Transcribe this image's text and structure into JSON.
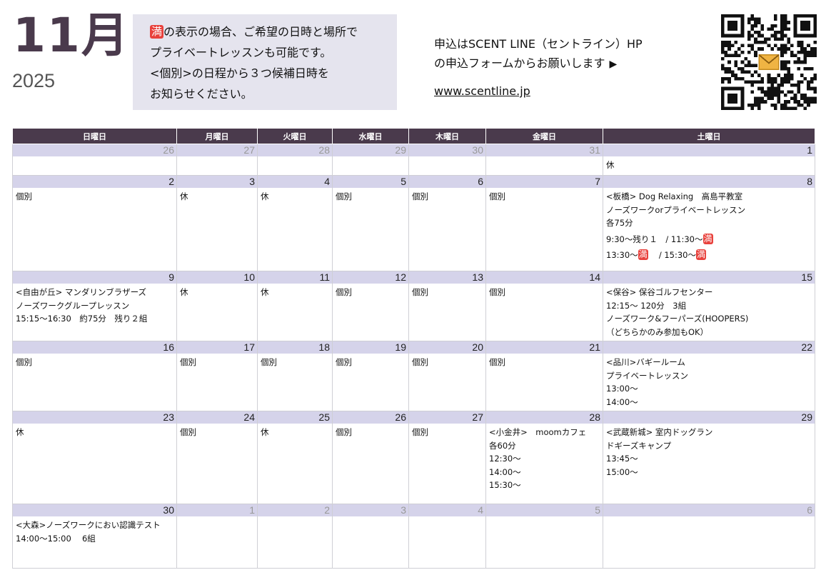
{
  "header": {
    "month": "11月",
    "year": "2025",
    "notice": {
      "badge": "満",
      "line1_after_badge": "の表示の場合、ご希望の日時と場所で",
      "line2": "プライベートレッスンも可能です。",
      "line3": "<個別>の日程から３つ候補日時を",
      "line4": "お知らせください。"
    },
    "apply": {
      "line1": "申込はSCENT LINE（セントライン）HP",
      "line2": "の申込フォームからお願いします",
      "arrow": "▶",
      "link": "www.scentline.jp"
    }
  },
  "calendar": {
    "weekdays": [
      "日曜日",
      "月曜日",
      "火曜日",
      "水曜日",
      "木曜日",
      "金曜日",
      "土曜日"
    ],
    "full_badge": "満",
    "weeks": [
      [
        {
          "day": "26",
          "other": true,
          "lines": []
        },
        {
          "day": "27",
          "other": true,
          "lines": []
        },
        {
          "day": "28",
          "other": true,
          "lines": []
        },
        {
          "day": "29",
          "other": true,
          "lines": []
        },
        {
          "day": "30",
          "other": true,
          "lines": []
        },
        {
          "day": "31",
          "other": true,
          "lines": []
        },
        {
          "day": "1",
          "lines": [
            "休"
          ]
        }
      ],
      [
        {
          "day": "2",
          "lines": [
            "個別"
          ]
        },
        {
          "day": "3",
          "lines": [
            "休"
          ]
        },
        {
          "day": "4",
          "lines": [
            "休"
          ]
        },
        {
          "day": "5",
          "lines": [
            "個別"
          ]
        },
        {
          "day": "6",
          "lines": [
            "個別"
          ]
        },
        {
          "day": "7",
          "lines": [
            "個別"
          ]
        },
        {
          "day": "8",
          "lines": [
            "<板橋> Dog Relaxing　高島平教室",
            "ノーズワークorプライベートレッスン",
            "各75分"
          ],
          "slots": [
            [
              {
                "text": " 9:30〜残り１　/ 11:30〜"
              },
              {
                "full": true
              }
            ],
            [
              {
                "text": "13:30〜"
              },
              {
                "full": true
              },
              {
                "text": "　 / 15:30〜"
              },
              {
                "full": true
              }
            ]
          ]
        }
      ],
      [
        {
          "day": "9",
          "lines": [
            "<自由が丘> マンダリンブラザーズ",
            "ノーズワークグループレッスン",
            "15:15〜16:30　約75分　残り２組"
          ]
        },
        {
          "day": "10",
          "lines": [
            "休"
          ]
        },
        {
          "day": "11",
          "lines": [
            "休"
          ]
        },
        {
          "day": "12",
          "lines": [
            "個別"
          ]
        },
        {
          "day": "13",
          "lines": [
            "個別"
          ]
        },
        {
          "day": "14",
          "lines": [
            "個別"
          ]
        },
        {
          "day": "15",
          "lines": [
            "<保谷> 保谷ゴルフセンター",
            "12:15〜 120分　3組",
            "ノーズワーク&フーパーズ(HOOPERS)",
            "（どちらかのみ参加もOK）"
          ]
        }
      ],
      [
        {
          "day": "16",
          "lines": [
            "個別"
          ]
        },
        {
          "day": "17",
          "lines": [
            "個別"
          ]
        },
        {
          "day": "18",
          "lines": [
            "個別"
          ]
        },
        {
          "day": "19",
          "lines": [
            "個別"
          ]
        },
        {
          "day": "20",
          "lines": [
            "個別"
          ]
        },
        {
          "day": "21",
          "lines": [
            "個別"
          ]
        },
        {
          "day": "22",
          "lines": [
            "<品川>バギールーム",
            "プライベートレッスン",
            "13:00〜",
            "14:00〜"
          ]
        }
      ],
      [
        {
          "day": "23",
          "lines": [
            "休"
          ]
        },
        {
          "day": "24",
          "lines": [
            "個別"
          ]
        },
        {
          "day": "25",
          "lines": [
            "休"
          ]
        },
        {
          "day": "26",
          "lines": [
            "個別"
          ]
        },
        {
          "day": "27",
          "lines": [
            "個別"
          ]
        },
        {
          "day": "28",
          "lines": [
            "<小金井>　moomカフェ",
            "各60分",
            "12:30〜",
            "14:00〜",
            "15:30〜"
          ]
        },
        {
          "day": "29",
          "lines": [
            "<武蔵新城> 室内ドッグラン",
            "ドギーズキャンプ",
            "13:45〜",
            "15:00〜"
          ]
        }
      ],
      [
        {
          "day": "30",
          "lines": [
            "<大森>ノーズワークにおい認識テスト",
            "14:00〜15:00　 6組"
          ]
        },
        {
          "day": "1",
          "other": true,
          "lines": []
        },
        {
          "day": "2",
          "other": true,
          "lines": []
        },
        {
          "day": "3",
          "other": true,
          "lines": []
        },
        {
          "day": "4",
          "other": true,
          "lines": []
        },
        {
          "day": "5",
          "other": true,
          "lines": []
        },
        {
          "day": "6",
          "other": true,
          "lines": []
        }
      ]
    ]
  },
  "icons": {
    "qr": "qr-code-icon"
  },
  "colors": {
    "header_bar": "#4a3a4c",
    "day_row": "#d5d3ea",
    "notice_bg": "#e5e4ee",
    "full_badge": "#e8413c"
  }
}
